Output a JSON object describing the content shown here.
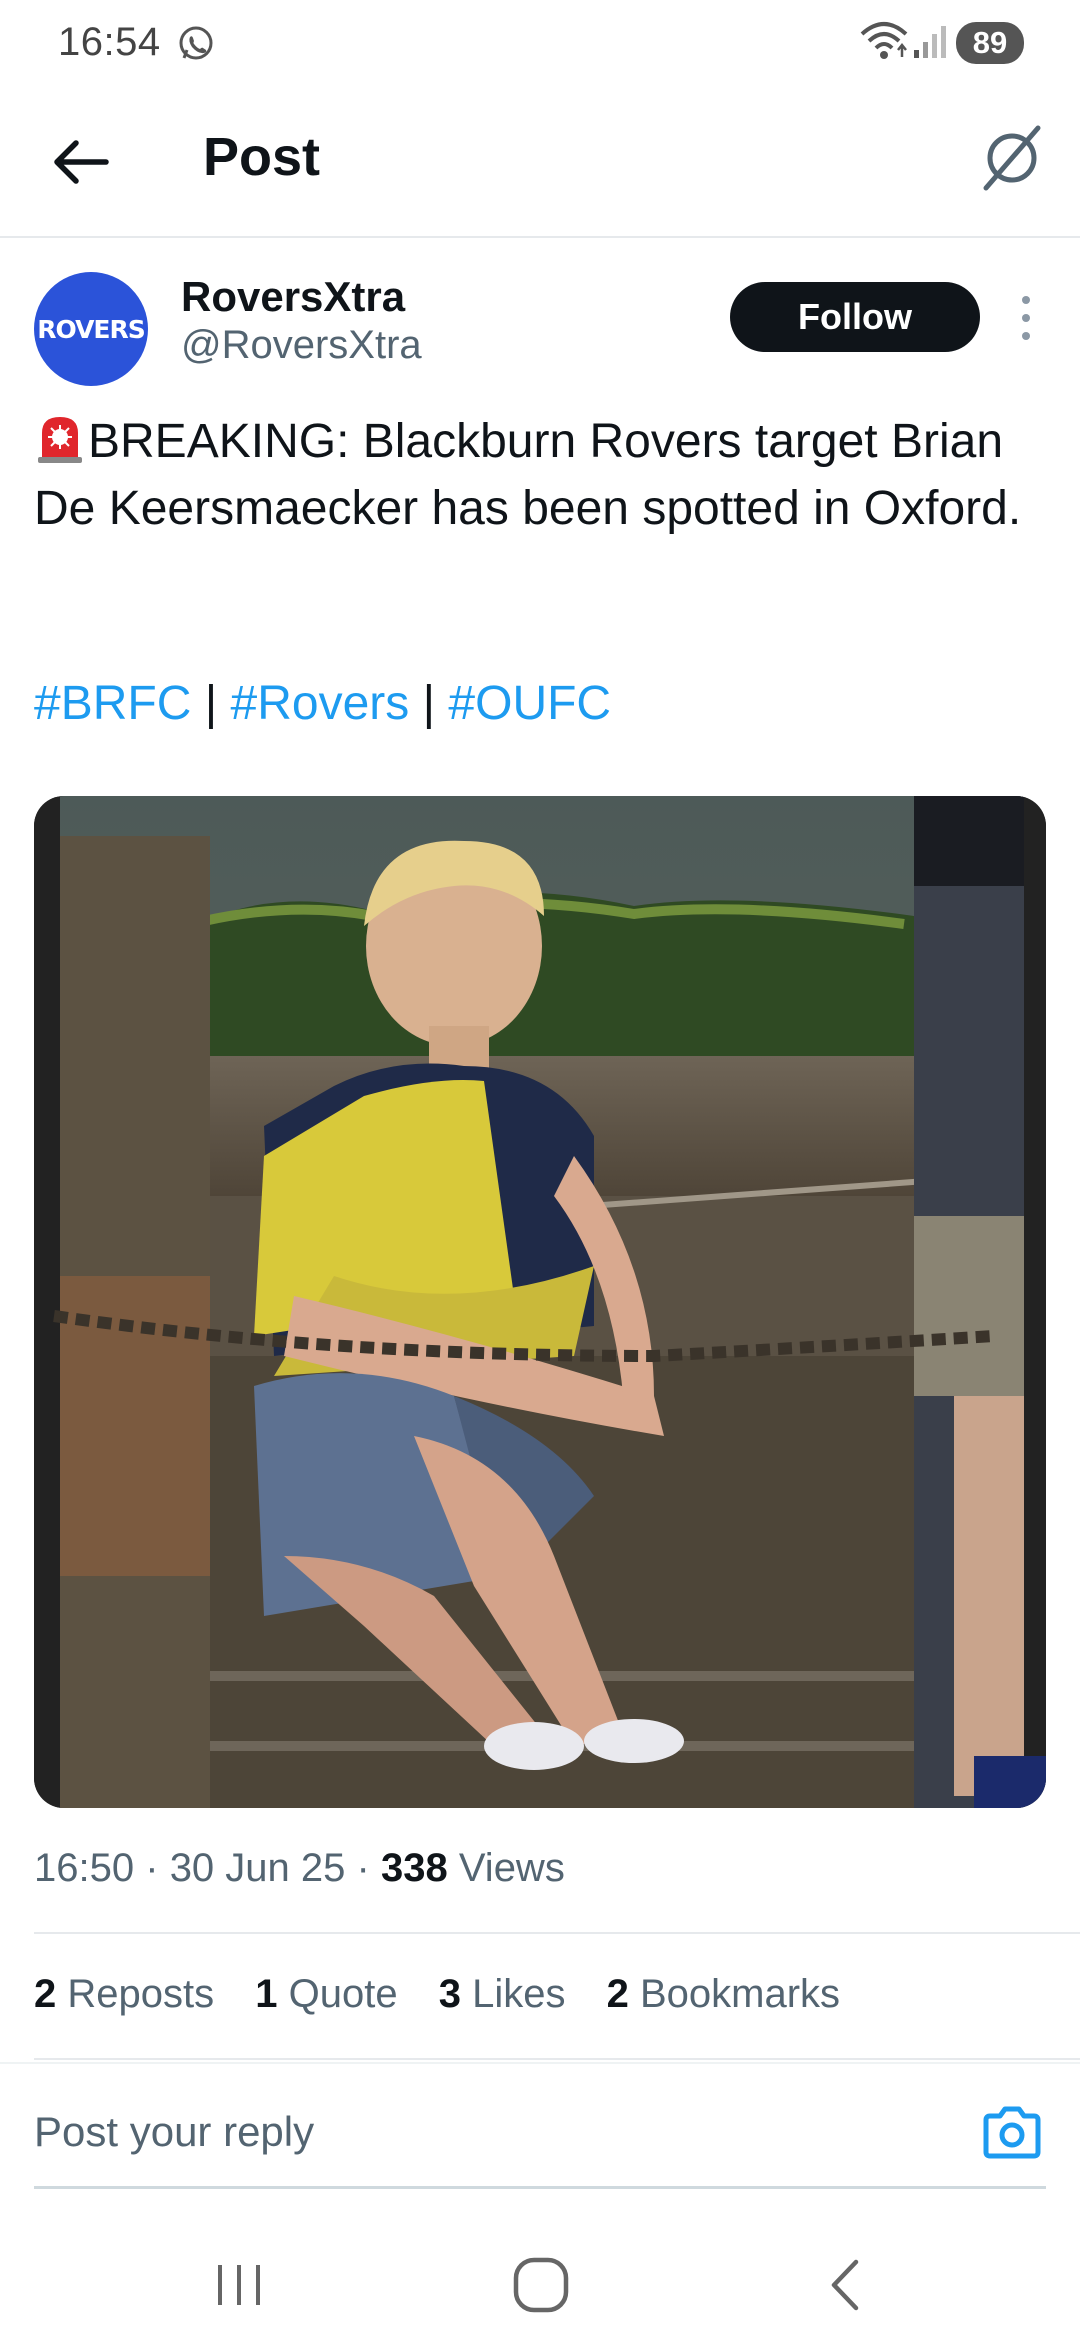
{
  "status_bar": {
    "time": "16:54",
    "battery": "89"
  },
  "header": {
    "title": "Post"
  },
  "post": {
    "display_name": "RoversXtra",
    "handle": "@RoversXtra",
    "avatar_text": "ROVERS",
    "follow_label": "Follow",
    "text": "BREAKING: Blackburn Rovers target Brian De Keersmaecker has been spotted in Oxford.",
    "hashtags": [
      "#BRFC",
      "#Rovers",
      "#OUFC"
    ],
    "hashtag_separator": "|",
    "time": "16:50",
    "date": "30 Jun 25",
    "meta_separator": "·",
    "views_count": "338",
    "views_label": "Views"
  },
  "stats": {
    "reposts_count": "2",
    "reposts_label": "Reposts",
    "quotes_count": "1",
    "quotes_label": "Quote",
    "likes_count": "3",
    "likes_label": "Likes",
    "bookmarks_count": "2",
    "bookmarks_label": "Bookmarks"
  },
  "reply": {
    "placeholder": "Post your reply"
  },
  "colors": {
    "link": "#1d9bf0",
    "text": "#0f1419",
    "muted": "#536471",
    "avatar_bg": "#2b53d9"
  }
}
